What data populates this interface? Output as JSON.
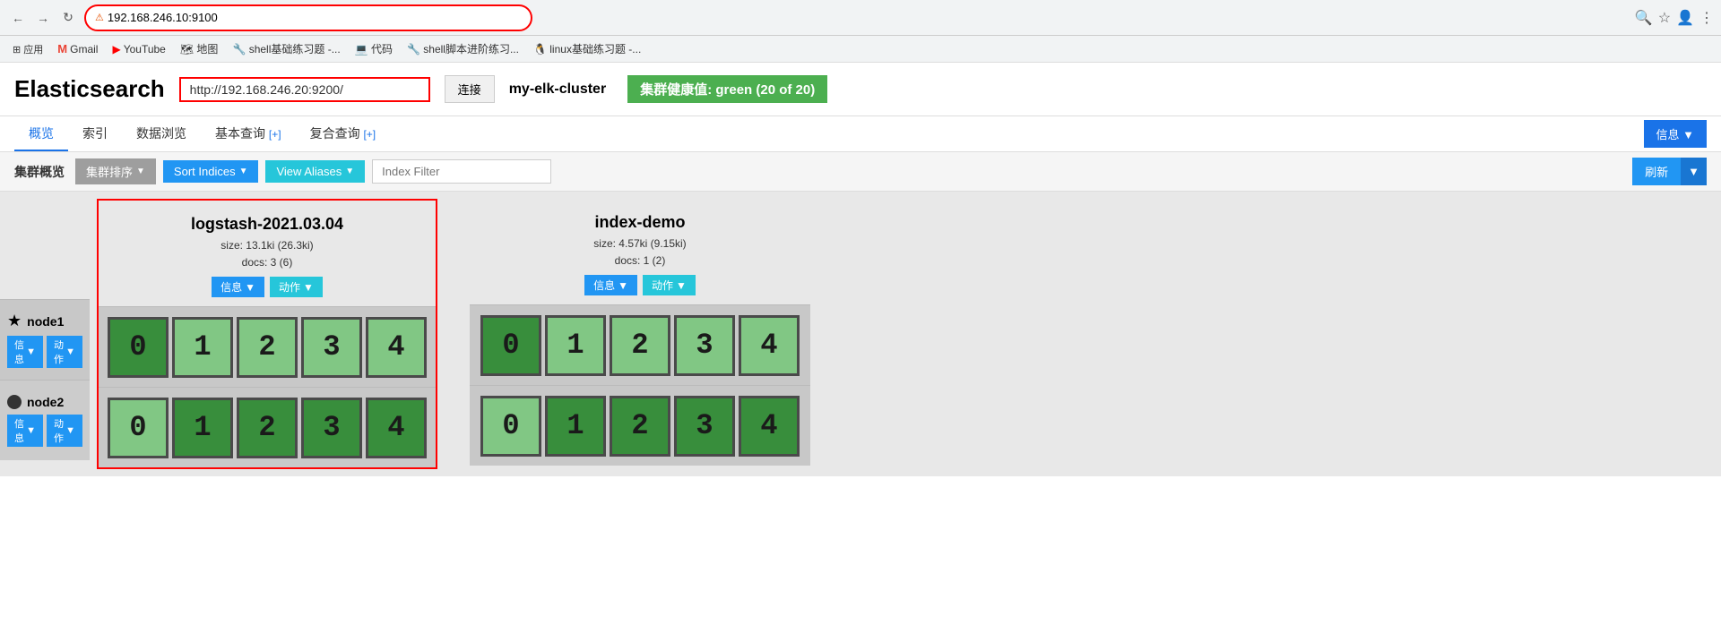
{
  "browser": {
    "address": "192.168.246.10:9100",
    "address_warning": "不安全",
    "bookmarks": [
      {
        "label": "应用",
        "icon": "⊞"
      },
      {
        "label": "Gmail",
        "icon": "M"
      },
      {
        "label": "YouTube",
        "icon": "▶"
      },
      {
        "label": "地图",
        "icon": "🗺"
      },
      {
        "label": "shell基础练习题 -...",
        "icon": "🔧"
      },
      {
        "label": "代码",
        "icon": "💻"
      },
      {
        "label": "shell脚本进阶练习...",
        "icon": "🔧"
      },
      {
        "label": "linux基础练习题 -...",
        "icon": "🐧"
      }
    ]
  },
  "app": {
    "title": "Elasticsearch",
    "connection_url": "http://192.168.246.20:9200/",
    "connect_label": "连接",
    "cluster_name": "my-elk-cluster",
    "health_badge": "集群健康值: green (20 of 20)",
    "health_color": "#4caf50"
  },
  "nav": {
    "tabs": [
      {
        "label": "概览",
        "active": true
      },
      {
        "label": "索引"
      },
      {
        "label": "数据浏览"
      },
      {
        "label": "基本查询 [+]"
      },
      {
        "label": "复合查询 [+]"
      }
    ],
    "info_label": "信息",
    "info_caret": "▼"
  },
  "toolbar": {
    "section_label": "集群概览",
    "cluster_sort_label": "集群排序",
    "cluster_sort_caret": "▼",
    "sort_indices_label": "Sort Indices",
    "sort_indices_caret": "▼",
    "view_aliases_label": "View Aliases",
    "view_aliases_caret": "▼",
    "index_filter_placeholder": "Index Filter",
    "refresh_label": "刷新",
    "refresh_caret": "▼"
  },
  "nodes": [
    {
      "name": "node1",
      "icon": "star",
      "info_label": "信息",
      "action_label": "动作"
    },
    {
      "name": "node2",
      "icon": "circle",
      "info_label": "信息",
      "action_label": "动作"
    }
  ],
  "indices": [
    {
      "name": "logstash-2021.03.04",
      "size": "size: 13.1ki (26.3ki)",
      "docs": "docs: 3 (6)",
      "highlighted": true,
      "info_label": "信息",
      "action_label": "动作",
      "shards_node1": [
        0,
        1,
        2,
        3,
        4
      ],
      "shards_node2": [
        0,
        1,
        2,
        3,
        4
      ],
      "node1_shard_styles": [
        "dark",
        "light",
        "light",
        "light",
        "light"
      ],
      "node2_shard_styles": [
        "light",
        "dark",
        "dark",
        "dark",
        "dark"
      ]
    },
    {
      "name": "index-demo",
      "size": "size: 4.57ki (9.15ki)",
      "docs": "docs: 1 (2)",
      "highlighted": false,
      "info_label": "信息",
      "action_label": "动作",
      "shards_node1": [
        0,
        1,
        2,
        3,
        4
      ],
      "shards_node2": [
        0,
        1,
        2,
        3,
        4
      ],
      "node1_shard_styles": [
        "dark",
        "light",
        "light",
        "light",
        "light"
      ],
      "node2_shard_styles": [
        "light",
        "dark",
        "dark",
        "dark",
        "dark"
      ]
    }
  ]
}
